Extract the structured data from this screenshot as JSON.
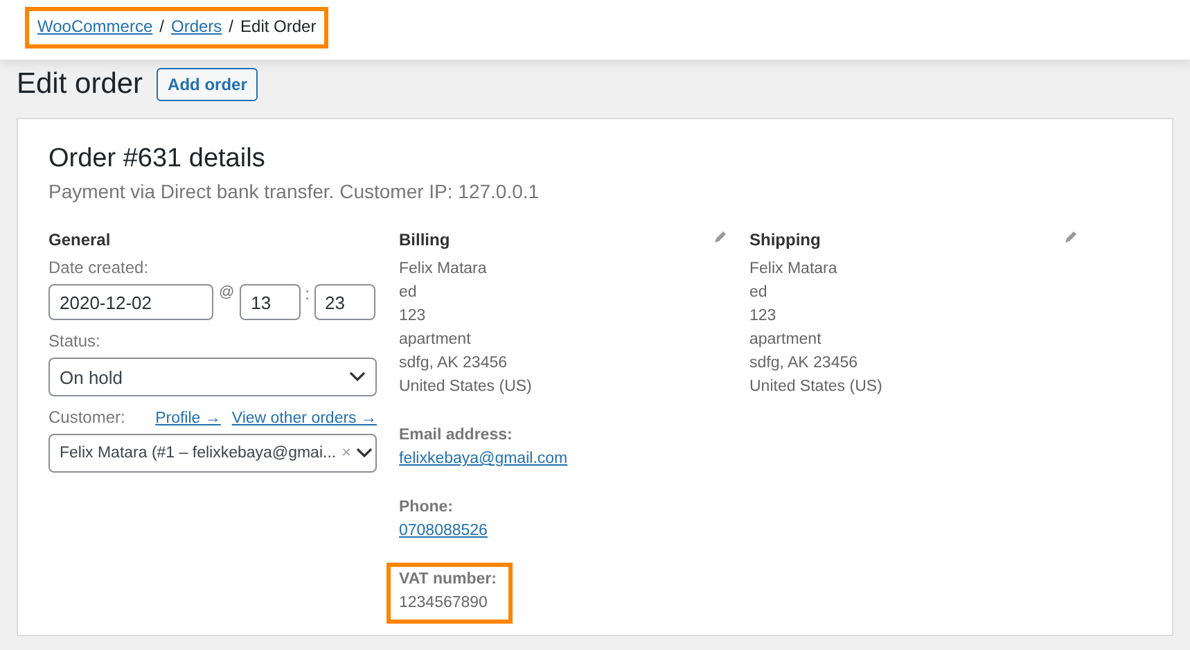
{
  "breadcrumb": {
    "highlighted": true,
    "links": [
      "WooCommerce",
      "Orders"
    ],
    "separator": "/",
    "current": "Edit Order"
  },
  "page": {
    "title": "Edit order",
    "add_button": "Add order"
  },
  "order": {
    "title": "Order #631 details",
    "meta": "Payment via Direct bank transfer. Customer IP: 127.0.0.1"
  },
  "general": {
    "heading": "General",
    "date_label": "Date created:",
    "date": "2020-12-02",
    "at": "@",
    "hour": "13",
    "colon": ":",
    "minute": "23",
    "status_label": "Status:",
    "status": "On hold",
    "customer_label": "Customer:",
    "profile_link": "Profile →",
    "orders_link": "View other orders →",
    "customer": "Felix Matara (#1 – felixkebaya@gmai...",
    "clear": "×"
  },
  "billing": {
    "heading": "Billing",
    "address": [
      "Felix Matara",
      "ed",
      "123",
      "apartment",
      "sdfg, AK 23456",
      "United States (US)"
    ],
    "fields": [
      {
        "label": "Email address:",
        "value": "felixkebaya@gmail.com",
        "kind": "link",
        "highlighted": false
      },
      {
        "label": "Phone:",
        "value": "0708088526",
        "kind": "link",
        "highlighted": false
      },
      {
        "label": "VAT number:",
        "value": "1234567890",
        "kind": "text",
        "highlighted": true
      }
    ]
  },
  "shipping": {
    "heading": "Shipping",
    "address": [
      "Felix Matara",
      "ed",
      "123",
      "apartment",
      "sdfg, AK 23456",
      "United States (US)"
    ]
  }
}
